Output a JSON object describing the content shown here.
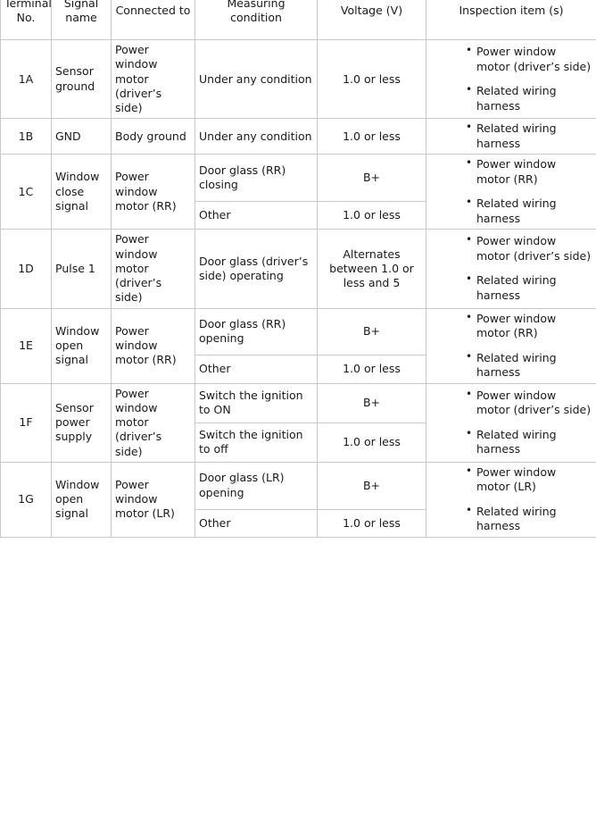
{
  "table": {
    "headers": [
      {
        "id": "terminal",
        "lines": [
          "Terminal",
          "No."
        ]
      },
      {
        "id": "name",
        "lines": [
          "Signal",
          "name"
        ]
      },
      {
        "id": "connected",
        "lines": [
          "Connected to"
        ]
      },
      {
        "id": "condition",
        "lines": [
          "Measuring",
          "condition"
        ]
      },
      {
        "id": "voltage",
        "lines": [
          "Voltage (V)"
        ]
      },
      {
        "id": "inspection",
        "lines": [
          "Inspection item (s)"
        ]
      }
    ],
    "rows": [
      {
        "terminal": "1A",
        "name": "Sensor ground",
        "connected": "Power window motor (driver’s side)",
        "measurements": [
          {
            "condition": "Under any condition",
            "voltage": "1.0 or less"
          }
        ],
        "inspection": [
          "Power window motor (driver’s side)",
          "Related wiring harness"
        ]
      },
      {
        "terminal": "1B",
        "name": "GND",
        "connected": "Body ground",
        "measurements": [
          {
            "condition": "Under any condition",
            "voltage": "1.0 or less"
          }
        ],
        "inspection": [
          "Related wiring harness"
        ]
      },
      {
        "terminal": "1C",
        "name": "Window close signal",
        "connected": "Power window motor (RR)",
        "measurements": [
          {
            "condition": "Door glass (RR) closing",
            "voltage": "B+"
          },
          {
            "condition": "Other",
            "voltage": "1.0 or less"
          }
        ],
        "inspection": [
          "Power window motor (RR)",
          "Related wiring harness"
        ]
      },
      {
        "terminal": "1D",
        "name": "Pulse 1",
        "connected": "Power window motor (driver’s side)",
        "measurements": [
          {
            "condition": "Door glass (driver’s side) operating",
            "voltage": "Alternates between 1.0 or less and 5"
          }
        ],
        "inspection": [
          "Power window motor (driver’s side)",
          "Related wiring harness"
        ]
      },
      {
        "terminal": "1E",
        "name": "Window open signal",
        "connected": "Power window motor (RR)",
        "measurements": [
          {
            "condition": "Door glass (RR) opening",
            "voltage": "B+"
          },
          {
            "condition": "Other",
            "voltage": "1.0 or less"
          }
        ],
        "inspection": [
          "Power window motor (RR)",
          "Related wiring harness"
        ]
      },
      {
        "terminal": "1F",
        "name": "Sensor power supply",
        "connected": "Power window motor (driver’s side)",
        "measurements": [
          {
            "condition": "Switch the ignition to ON",
            "voltage": "B+"
          },
          {
            "condition": "Switch the ignition to off",
            "voltage": "1.0 or less"
          }
        ],
        "inspection": [
          "Power window motor (driver’s side)",
          "Related wiring harness"
        ]
      },
      {
        "terminal": "1G",
        "name": "Window open signal",
        "connected": "Power window motor (LR)",
        "measurements": [
          {
            "condition": "Door glass (LR) opening",
            "voltage": "B+"
          },
          {
            "condition": "Other",
            "voltage": "1.0 or less"
          }
        ],
        "inspection": [
          "Power window motor (LR)",
          "Related wiring harness"
        ]
      }
    ]
  },
  "style": {
    "border_color": "#c9c9c9",
    "sub_border_color": "#dcdcdc",
    "text_color": "#1a1a1a",
    "background": "#ffffff"
  }
}
